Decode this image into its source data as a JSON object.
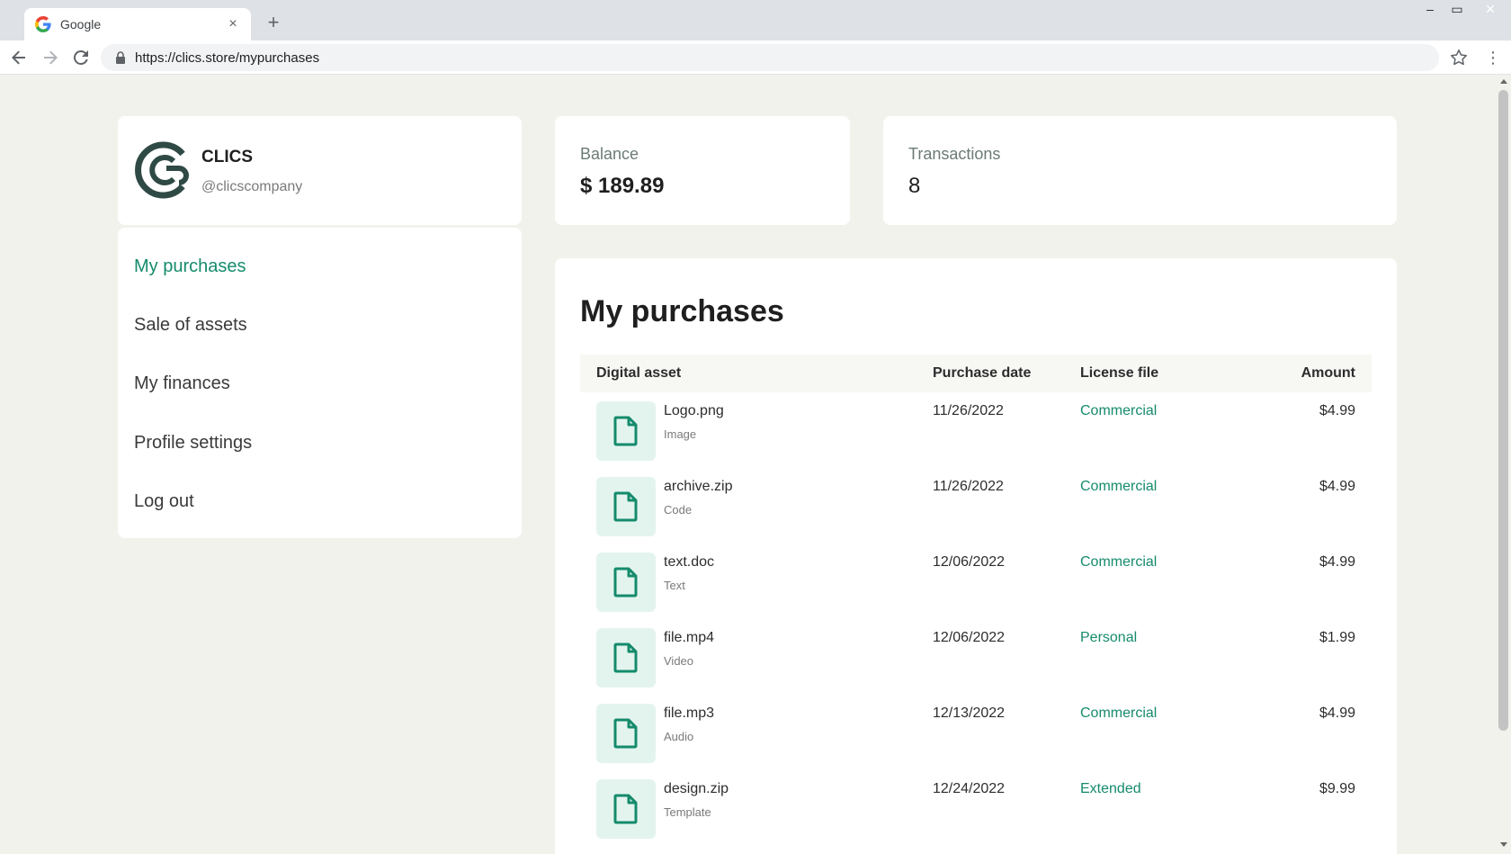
{
  "browser": {
    "tab_title": "Google",
    "tab_close": "×",
    "new_tab": "+",
    "url": "https://clics.store/mypurchases",
    "window_controls": {
      "minimize": "–",
      "maximize": "▭",
      "close": "✕"
    }
  },
  "profile": {
    "name": "CLICS",
    "handle": "@clicscompany"
  },
  "sidebar": {
    "items": [
      {
        "label": "My purchases",
        "active": true
      },
      {
        "label": "Sale of assets",
        "active": false
      },
      {
        "label": "My finances",
        "active": false
      },
      {
        "label": "Profile settings",
        "active": false
      },
      {
        "label": "Log out",
        "active": false
      }
    ]
  },
  "stats": {
    "balance_label": "Balance",
    "balance_value": "$ 189.89",
    "transactions_label": "Transactions",
    "transactions_value": "8"
  },
  "purchases": {
    "title": "My purchases",
    "columns": {
      "asset": "Digital asset",
      "date": "Purchase date",
      "license": "License file",
      "amount": "Amount"
    },
    "rows": [
      {
        "name": "Logo.png",
        "type": "Image",
        "date": "11/26/2022",
        "license": "Commercial",
        "amount": "$4.99"
      },
      {
        "name": "archive.zip",
        "type": "Code",
        "date": "11/26/2022",
        "license": "Commercial",
        "amount": "$4.99"
      },
      {
        "name": "text.doc",
        "type": "Text",
        "date": "12/06/2022",
        "license": "Commercial",
        "amount": "$4.99"
      },
      {
        "name": "file.mp4",
        "type": "Video",
        "date": "12/06/2022",
        "license": "Personal",
        "amount": "$1.99"
      },
      {
        "name": "file.mp3",
        "type": "Audio",
        "date": "12/13/2022",
        "license": "Commercial",
        "amount": "$4.99"
      },
      {
        "name": "design.zip",
        "type": "Template",
        "date": "12/24/2022",
        "license": "Extended",
        "amount": "$9.99"
      }
    ]
  },
  "colors": {
    "accent": "#158b6c",
    "page_background": "#f2f2ec",
    "file_tile": "#e3f4ee",
    "logo": "#2f4a45"
  }
}
